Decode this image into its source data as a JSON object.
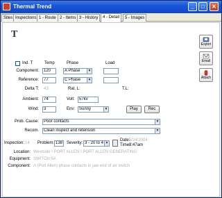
{
  "window": {
    "title": "Thermal Trend",
    "minimize": "_",
    "maximize": "□",
    "close": "✕"
  },
  "tabs": [
    {
      "label": "Sites"
    },
    {
      "label": "Inspections"
    },
    {
      "label": "1 - Route"
    },
    {
      "label": "2 - Items"
    },
    {
      "label": "3 - History"
    },
    {
      "label": "4 - Detail"
    },
    {
      "label": "5 - Images"
    }
  ],
  "side_buttons": {
    "export": "Export",
    "email": "Email",
    "attach": "Attach"
  },
  "logo": "T",
  "headers": {
    "ind_t": "Ind. T",
    "temp": "Temp",
    "phase": "Phase",
    "load": "Load"
  },
  "form": {
    "component_label": "Component:",
    "component_temp": "120",
    "component_phase": "A Phase",
    "reference_label": "Reference:",
    "reference_temp": "77",
    "reference_phase": "C Phase",
    "delta_label": "Delta T:",
    "delta_value": "43",
    "rat_l_label": "Rat. L:",
    "tl_label": "T.L:",
    "ambient_label": "Ambient:",
    "ambient_value": "74",
    "volt_label": "Volt:",
    "volt_value": "57kv",
    "wind_label": "Wind:",
    "wind_value": "3",
    "env_label": "Env:",
    "env_value": "Sunny",
    "play_button": "Play",
    "rec_button": "Rec",
    "prob_cause_label": "Prob. Cause:",
    "prob_cause_value": "Poor contacts",
    "recom_label": "Recom.",
    "recom_value": "Clean inspect and retension"
  },
  "footer": {
    "inspection_label": "Inspection:",
    "inspection_value": "14",
    "problem_label": "Problem:",
    "problem_value": "138",
    "severity_label": "Severity:",
    "severity_value": "3 - 20 to 4",
    "date_label": "Date:",
    "date_value": "5/24/2004",
    "time_label": "Time:",
    "time_value": "8:47am",
    "location_label": "Location:",
    "location_value": "Westside \\ PORT ALLEN \\ PORT ALLEN GENERATING",
    "equipment_label": "Equipment:",
    "equipment_value": "SWITCH 5A",
    "component_label": "Component:",
    "component_value": "A (Port Allen) phase contacts in jaw end of air switch"
  }
}
